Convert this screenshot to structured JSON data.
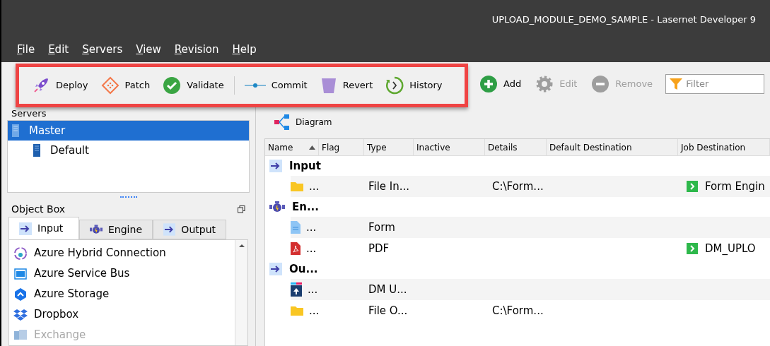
{
  "window": {
    "title": "UPLOAD_MODULE_DEMO_SAMPLE - Lasernet Developer 9"
  },
  "menu": [
    "File",
    "Edit",
    "Servers",
    "View",
    "Revision",
    "Help"
  ],
  "toolbar": {
    "highlighted": [
      {
        "label": "Deploy",
        "disabled": false
      },
      {
        "label": "Patch",
        "disabled": false
      },
      {
        "label": "Validate",
        "disabled": false
      },
      {
        "label": "Commit",
        "disabled": false
      },
      {
        "label": "Revert",
        "disabled": false
      },
      {
        "label": "History",
        "disabled": false
      }
    ],
    "other": [
      {
        "label": "Add",
        "disabled": false
      },
      {
        "label": "Edit",
        "disabled": true
      },
      {
        "label": "Remove",
        "disabled": true
      }
    ],
    "filter": {
      "placeholder": "Filter"
    }
  },
  "servers": {
    "title": "Servers",
    "items": [
      {
        "label": "Master",
        "selected": true,
        "children": [
          {
            "label": "Default",
            "selected": false
          }
        ]
      }
    ]
  },
  "object_box": {
    "title": "Object Box",
    "tabs": [
      {
        "label": "Input",
        "selected": true
      },
      {
        "label": "Engine",
        "selected": false
      },
      {
        "label": "Output",
        "selected": false
      }
    ],
    "items": [
      {
        "label": "Azure Hybrid Connection",
        "disabled": false
      },
      {
        "label": "Azure Service Bus",
        "disabled": false
      },
      {
        "label": "Azure Storage",
        "disabled": false
      },
      {
        "label": "Dropbox",
        "disabled": false
      },
      {
        "label": "Exchange",
        "disabled": true
      }
    ]
  },
  "diagram_button": "Diagram",
  "table": {
    "columns": [
      "Name",
      "Flag",
      "Type",
      "Inactive",
      "Details",
      "Default Destination",
      "Job Destination"
    ],
    "rows": [
      {
        "kind": "group",
        "name": "Input"
      },
      {
        "kind": "item",
        "name": "...",
        "type": "File In...",
        "details": "C:\\Form...",
        "job_destination": "Form Engin"
      },
      {
        "kind": "group",
        "name": "En..."
      },
      {
        "kind": "item",
        "name": "...",
        "type": "Form"
      },
      {
        "kind": "item",
        "name": "...",
        "type": "PDF",
        "job_destination": "DM_UPLO"
      },
      {
        "kind": "group",
        "name": "Ou..."
      },
      {
        "kind": "item",
        "name": "...",
        "type": "DM U..."
      },
      {
        "kind": "item",
        "name": "...",
        "type": "File O...",
        "details": "C:\\Form..."
      }
    ]
  }
}
